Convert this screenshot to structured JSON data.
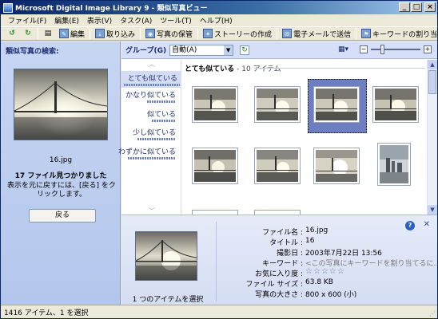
{
  "window": {
    "title": "Microsoft Digital Image Library 9 - 類似写真ビュー",
    "minimize": "_",
    "maximize": "□",
    "close": "×"
  },
  "menu": [
    "ファイル(F)",
    "編集(E)",
    "表示(V)",
    "タスク(A)",
    "ツール(T)",
    "ヘルプ(H)"
  ],
  "toolbar": {
    "back_icon": "back-arrow-icon",
    "forward_icon": "forward-arrow-icon",
    "edit": "編集",
    "import": "取り込み",
    "archive": "写真の保管",
    "story": "ストーリーの作成",
    "email": "電子メールで送信",
    "keyword": "キーワードの割り当て"
  },
  "left_pane": {
    "header": "類似写真の検索:",
    "filename": "16.jpg",
    "found": "17 ファイル見つかりました",
    "hint": "表示を元に戻すには、[戻る] をクリックします。",
    "back_button": "戻る"
  },
  "group_bar": {
    "label": "グループ(G)",
    "value": "自動(A)"
  },
  "similarity_nav": [
    {
      "label": "とても似ている",
      "level": 1.0,
      "selected": true
    },
    {
      "label": "かなり似ている",
      "level": 0.8,
      "selected": false
    },
    {
      "label": "似ている",
      "level": 0.6,
      "selected": false
    },
    {
      "label": "少し似ている",
      "level": 0.4,
      "selected": false
    },
    {
      "label": "わずかに似ている",
      "level": 0.2,
      "selected": false
    }
  ],
  "group_header": {
    "name": "とても似ている",
    "count": "- 10 アイテム"
  },
  "info": {
    "caption": "1 つのアイテムを選択",
    "properties": [
      {
        "label": "ファイル名 :",
        "value": "16.jpg"
      },
      {
        "label": "タイトル :",
        "value": "16"
      },
      {
        "label": "撮影日 :",
        "value": "2003年7月22日     13:56"
      },
      {
        "label": "キーワード :",
        "value": "<この写真にキーワードを割り当てるに…"
      },
      {
        "label": "お気に入り度 :",
        "value": "☆☆☆☆☆"
      },
      {
        "label": "ファイル サイズ :",
        "value": "63.8 KB"
      },
      {
        "label": "写真の大きさ :",
        "value": "800 x 600 (小)"
      }
    ]
  },
  "status": "1416 アイテム、1 を選択"
}
